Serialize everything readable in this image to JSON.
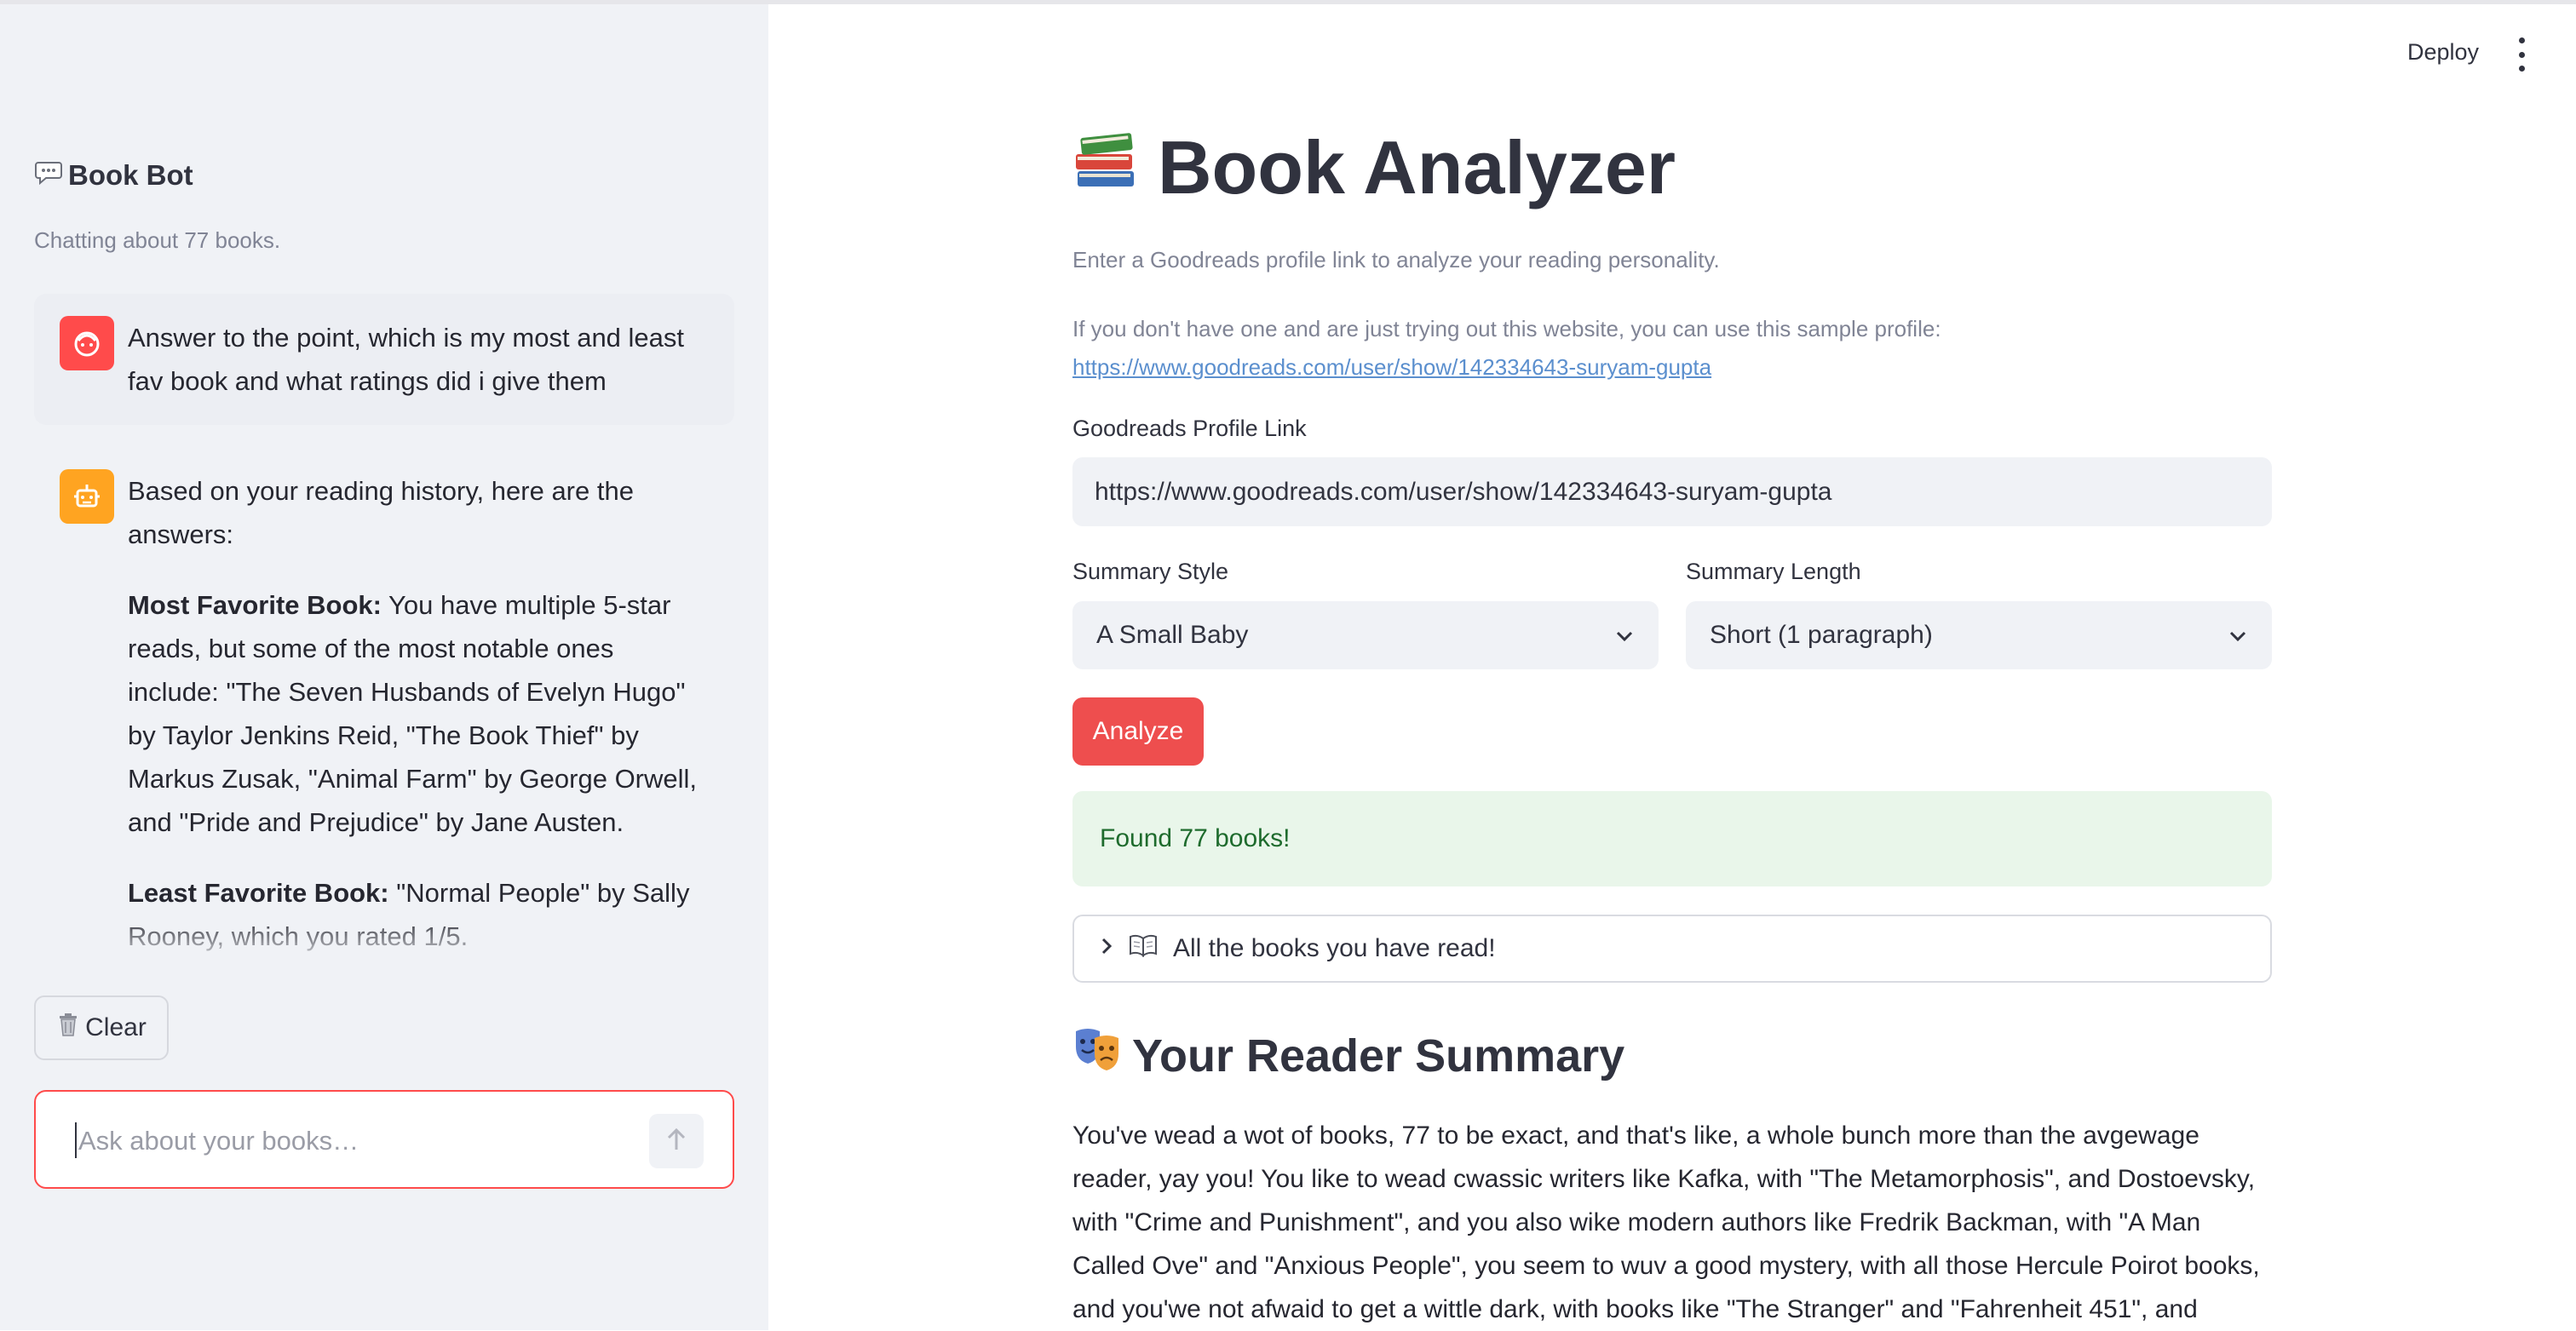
{
  "sidebar": {
    "title": "Book Bot",
    "title_icon": "speech-bubble-icon",
    "subtitle": "Chatting about 77 books.",
    "messages": [
      {
        "role": "user",
        "avatar_icon": "user-face-icon",
        "text": "Answer to the point, which is my most and least fav book and what ratings did i give them"
      },
      {
        "role": "assistant",
        "avatar_icon": "robot-icon",
        "intro": "Based on your reading history, here are the answers:",
        "most_label": "Most Favorite Book:",
        "most_text": " You have multiple 5-star reads, but some of the most notable ones include: \"The Seven Husbands of Evelyn Hugo\" by Taylor Jenkins Reid, \"The Book Thief\" by Markus Zusak, \"Animal Farm\" by George Orwell, and \"Pride and Prejudice\" by Jane Austen.",
        "least_label": "Least Favorite Book:",
        "least_text": " \"Normal People\" by Sally Rooney, which you rated 1/5."
      }
    ],
    "clear_label": "Clear",
    "clear_icon": "trash-can-icon",
    "chat_input_placeholder": "Ask about your books…"
  },
  "header": {
    "deploy_label": "Deploy"
  },
  "main": {
    "title": "Book Analyzer",
    "title_icon": "books-icon",
    "intro": "Enter a Goodreads profile link to analyze your reading personality.",
    "sample_text": "If you don't have one and are just trying out this website, you can use this sample profile:",
    "sample_link": "https://www.goodreads.com/user/show/142334643-suryam-gupta",
    "profile_label": "Goodreads Profile Link",
    "profile_value": "https://www.goodreads.com/user/show/142334643-suryam-gupta",
    "style_label": "Summary Style",
    "style_value": "A Small Baby",
    "length_label": "Summary Length",
    "length_value": "Short (1 paragraph)",
    "analyze_label": "Analyze",
    "success_text": "Found 77 books!",
    "expander_icon": "open-book-icon",
    "expander_label": "All the books you have read!",
    "summary_title": "Your Reader Summary",
    "summary_icon": "theater-masks-icon",
    "summary_text": "You've wead a wot of books, 77 to be exact, and that's like, a whole bunch more than the avgewage reader, yay you! You like to wead cwassic writers like Kafka, with \"The Metamorphosis\", and Dostoevsky, with \"Crime and Punishment\", and you also wike modern authors like Fredrik Backman, with \"A Man Called Ove\" and \"Anxious People\", you seem to wuv a good mystery, with all those Hercule Poirot books, and you'we not afwaid to get a wittle dark, with books like \"The Stranger\" and \"Fahrenheit 451\", and"
  },
  "colors": {
    "accent": "#ff4b4b",
    "sidebar_bg": "#f0f2f6",
    "bot_avatar": "#ffa421",
    "success_bg": "#e9f6ea",
    "success_text": "#1e6b2d",
    "link": "#5b8fce"
  }
}
